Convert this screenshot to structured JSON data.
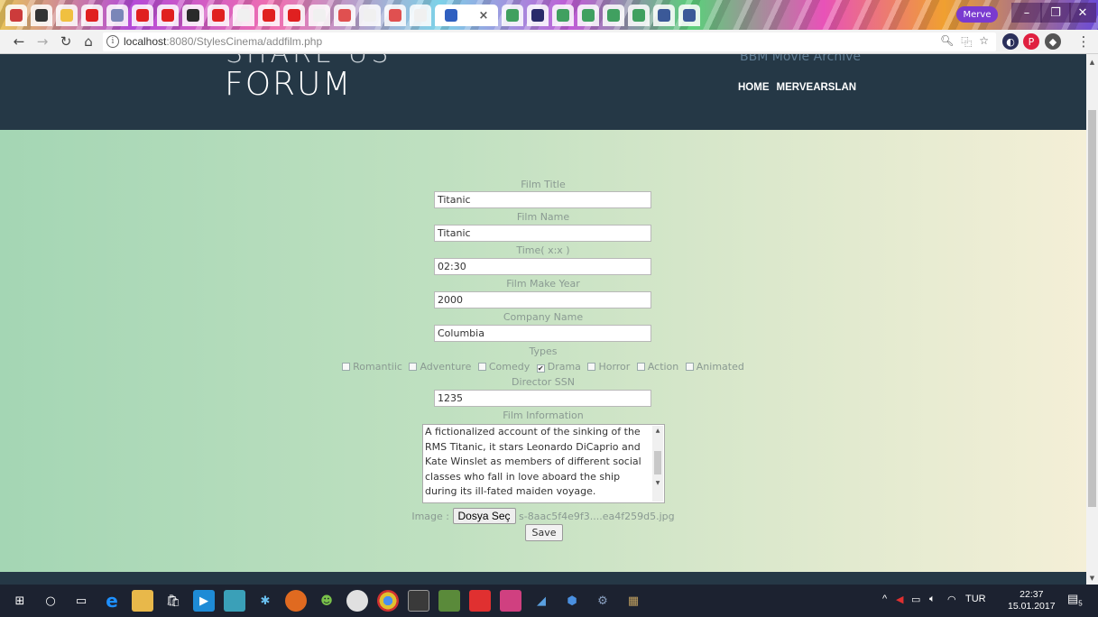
{
  "browser": {
    "url_host": "localhost",
    "url_path": ":8080/StylesCinema/addfilm.php",
    "profile_name": "Merve",
    "tab_close": "×"
  },
  "site": {
    "logo_top": "SHARE US",
    "logo": "FORUM",
    "archive_title": "BBM Movie Archive",
    "nav": [
      "HOME",
      "MERVEARSLAN"
    ]
  },
  "form": {
    "film_title_label": "Film Title",
    "film_title_value": "Titanic",
    "film_name_label": "Film Name",
    "film_name_value": "Titanic",
    "time_label": "Time( x:x )",
    "time_value": "02:30",
    "make_year_label": "Film Make Year",
    "make_year_value": "2000",
    "company_label": "Company Name",
    "company_value": "Columbia",
    "types_label": "Types",
    "types": [
      {
        "label": "Romantiic",
        "checked": false
      },
      {
        "label": "Adventure",
        "checked": false
      },
      {
        "label": "Comedy",
        "checked": false
      },
      {
        "label": "Drama",
        "checked": true
      },
      {
        "label": "Horror",
        "checked": false
      },
      {
        "label": "Action",
        "checked": false
      },
      {
        "label": "Animated",
        "checked": false
      }
    ],
    "director_label": "Director SSN",
    "director_value": "1235",
    "info_label": "Film Information",
    "info_text": "A fictionalized account of the sinking of the RMS Titanic, it stars Leonardo DiCaprio and Kate Winslet as members of different social classes who fall in love aboard the ship during its ill-fated maiden voyage.",
    "image_label": "Image :",
    "file_button": "Dosya Seç",
    "file_name": "s-8aac5f4e9f3....ea4f259d5.jpg",
    "save_button": "Save"
  },
  "taskbar": {
    "language": "TUR",
    "time": "22:37",
    "date": "15.01.2017",
    "notifications": "5"
  }
}
